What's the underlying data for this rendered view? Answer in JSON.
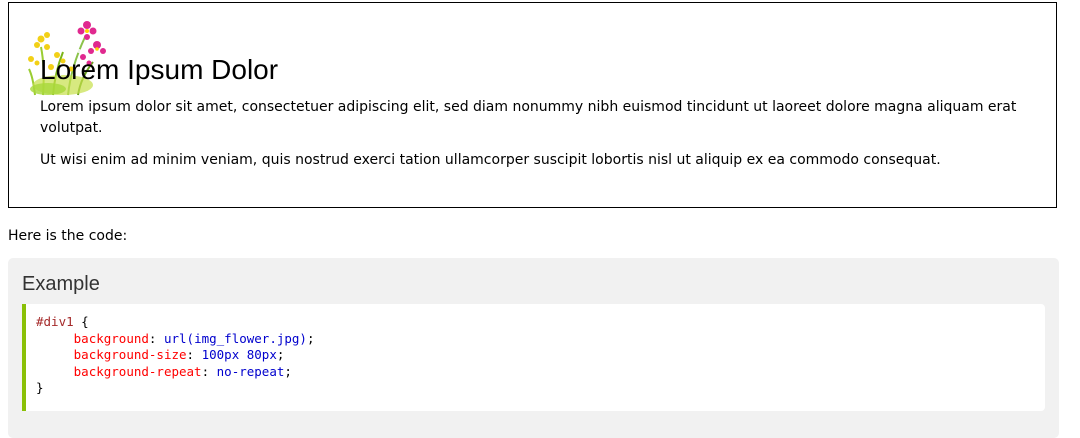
{
  "demo": {
    "title": "Lorem Ipsum Dolor",
    "paragraph1": "Lorem ipsum dolor sit amet, consectetuer adipiscing elit, sed diam nonummy nibh euismod tincidunt ut laoreet dolore magna aliquam erat volutpat.",
    "paragraph2": "Ut wisi enim ad minim veniam, quis nostrud exerci tation ullamcorper suscipit lobortis nisl ut aliquip ex ea commodo consequat.",
    "image_icon": "flower-icon"
  },
  "intro_text": "Here is the code:",
  "example": {
    "title": "Example",
    "accent_color": "#8ac007",
    "code": {
      "selector": "#div1",
      "open_brace": " {",
      "close_brace": "}",
      "declarations": [
        {
          "property": "background",
          "value": "url(img_flower.jpg)"
        },
        {
          "property": "background-size",
          "value": "100px 80px"
        },
        {
          "property": "background-repeat",
          "value": "no-repeat"
        }
      ]
    }
  }
}
